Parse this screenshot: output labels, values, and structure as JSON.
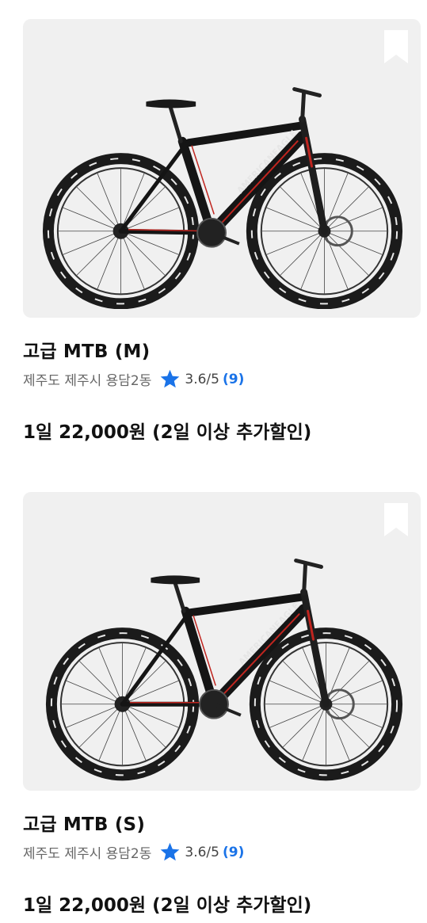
{
  "colors": {
    "star": "#1a73e8",
    "review_count": "#1a73e8",
    "image_bg": "#f0f0f0",
    "frame_accent": "#c0251f"
  },
  "listings": [
    {
      "title": "고급 MTB (M)",
      "location": "제주도 제주시 용담2동",
      "rating": "3.6/5",
      "reviews": "(9)",
      "price": "1일 22,000원 (2일 이상 추가할인)",
      "icons": [
        "bookmark-icon",
        "star-icon"
      ]
    },
    {
      "title": "고급 MTB (S)",
      "location": "제주도 제주시 용담2동",
      "rating": "3.6/5",
      "reviews": "(9)",
      "price": "1일 22,000원 (2일 이상 추가할인)",
      "icons": [
        "bookmark-icon",
        "star-icon"
      ]
    }
  ]
}
